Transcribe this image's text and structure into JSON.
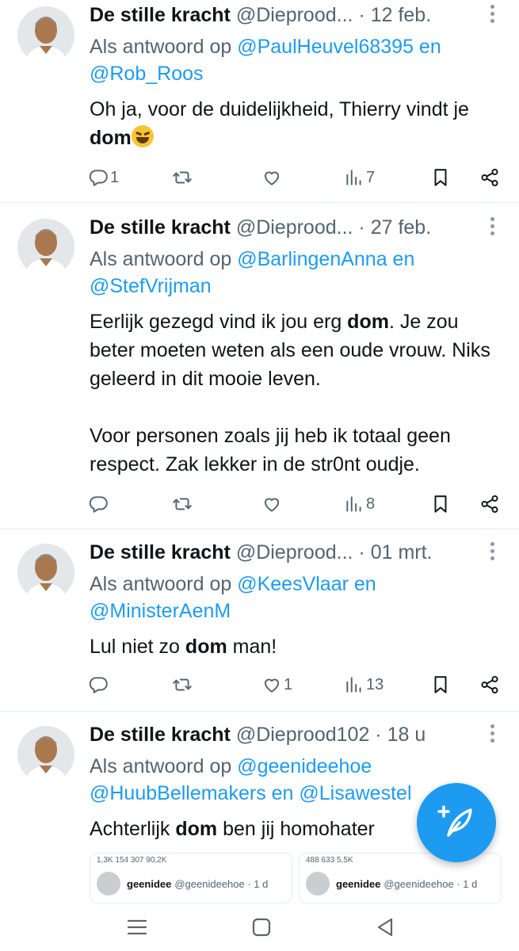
{
  "tweets": [
    {
      "name": "De stille kracht",
      "handle": "@Dieprood...",
      "sep": " · ",
      "date": "12 feb.",
      "reply_prefix": "Als antwoord op ",
      "reply_mentions_line1": "@PaulHeuvel68395 en",
      "reply_mentions_line2": "@Rob_Roos",
      "text_before": "Oh ja, voor de duidelijkheid, Thierry vindt je ",
      "text_bold": "dom",
      "text_after": "",
      "replies": "1",
      "likes": "",
      "views": "7"
    },
    {
      "name": "De stille kracht",
      "handle": "@Dieprood...",
      "sep": " · ",
      "date": "27 feb.",
      "reply_prefix": "Als antwoord op ",
      "reply_mentions_line1": "@BarlingenAnna en",
      "reply_mentions_line2": "@StefVrijman",
      "text_before": "Eerlijk gezegd vind ik jou erg ",
      "text_bold": "dom",
      "text_after": ". Je zou beter moeten weten als een oude vrouw. Niks geleerd in dit mooie leven.\n\nVoor personen zoals jij heb ik totaal geen respect. Zak lekker in de str0nt oudje.",
      "replies": "",
      "likes": "",
      "views": "8"
    },
    {
      "name": "De stille kracht",
      "handle": "@Dieprood...",
      "sep": " · ",
      "date": "01 mrt.",
      "reply_prefix": "Als antwoord op ",
      "reply_mentions_line1": "@KeesVlaar en",
      "reply_mentions_line2": "@MinisterAenM",
      "text_before": "Lul niet zo ",
      "text_bold": "dom",
      "text_after": " man!",
      "replies": "",
      "likes": "1",
      "views": "13"
    },
    {
      "name": "De stille kracht",
      "handle": "@Dieprood102",
      "sep": " · ",
      "date": "18 u",
      "reply_prefix": "Als antwoord op ",
      "reply_mentions_line1": "@geenideehoe",
      "reply_mentions_line2": "@HuubBellemakers en @Lisawestel",
      "text_before": "Achterlijk ",
      "text_bold": "dom",
      "text_after": " ben jij homohater",
      "replies": "",
      "likes": "",
      "views": ""
    }
  ],
  "embeds": [
    {
      "stats": "1,3K   154   307   90,2K",
      "user": "geenidee",
      "handle": "@geenideehoe · 1 d"
    },
    {
      "stats": "488   633   5,5K",
      "user": "geenidee",
      "handle": "@geenideehoe · 1 d"
    }
  ],
  "icons": {
    "reply": "reply-icon",
    "retweet": "retweet-icon",
    "like": "heart-icon",
    "views": "views-icon",
    "bookmark": "bookmark-icon",
    "share": "share-icon",
    "compose": "compose-icon"
  },
  "colors": {
    "accent": "#1d9bf0",
    "text": "#0f1419",
    "muted": "#536471"
  }
}
